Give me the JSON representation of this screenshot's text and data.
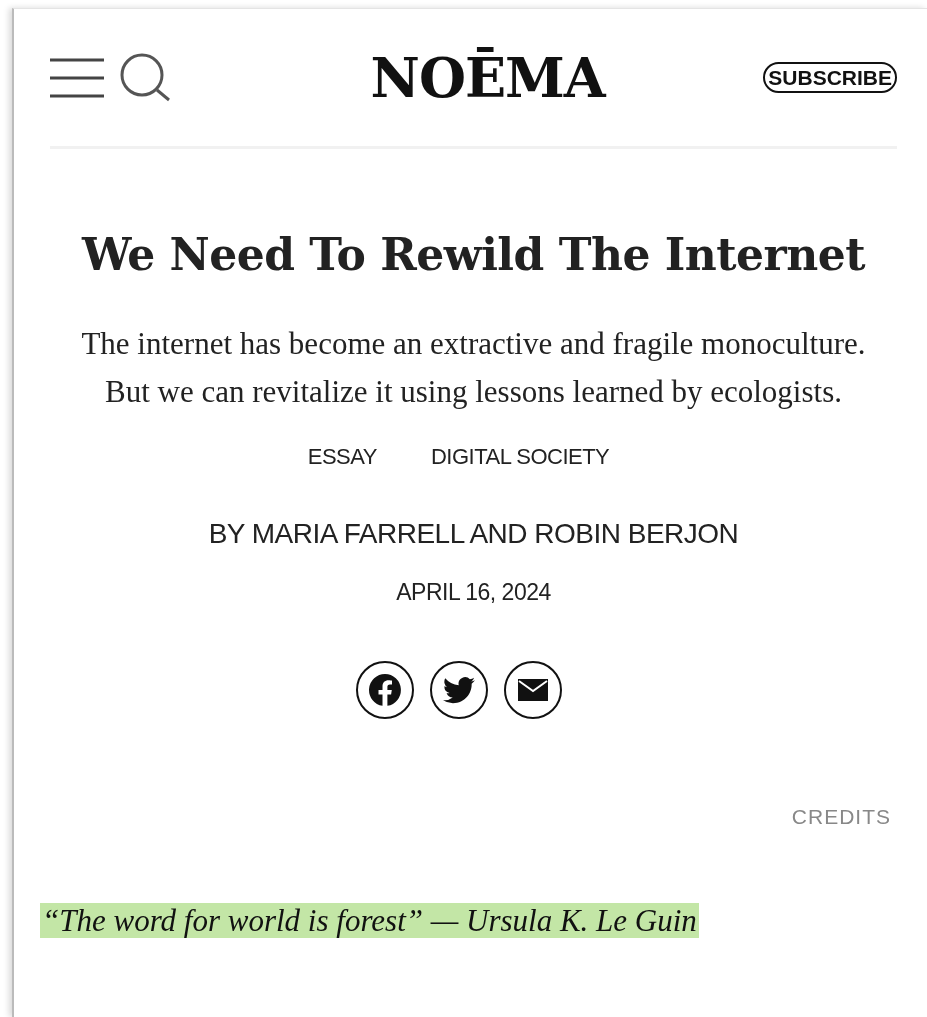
{
  "header": {
    "logo": "NOĒMA",
    "subscribe": "SUBSCRIBE"
  },
  "article": {
    "title": "We Need To Rewild The Internet",
    "dek": "The internet has become an extractive and fragile monoculture. But we can revitalize it using lessons learned by ecologists.",
    "tags": [
      "ESSAY",
      "DIGITAL SOCIETY"
    ],
    "byline": "BY MARIA FARRELL AND ROBIN BERJON",
    "date": "APRIL 16, 2024",
    "share": [
      {
        "kind": "facebook"
      },
      {
        "kind": "twitter"
      },
      {
        "kind": "email"
      }
    ],
    "credits": "CREDITS",
    "epigraph": {
      "text": "“The word for world is forest” — Ursula K. Le Guin",
      "highlighted": true
    }
  }
}
